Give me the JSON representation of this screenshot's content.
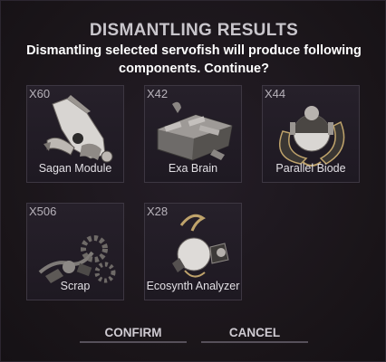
{
  "dialog": {
    "title": "DISMANTLING RESULTS",
    "message": "Dismantling selected servofish will produce following components. Continue?"
  },
  "components": [
    {
      "qty": "X60",
      "name": "Sagan Module",
      "icon": "sagan-module-icon"
    },
    {
      "qty": "X42",
      "name": "Exa Brain",
      "icon": "exa-brain-icon"
    },
    {
      "qty": "X44",
      "name": "Parallel Biode",
      "icon": "parallel-biode-icon"
    },
    {
      "qty": "X506",
      "name": "Scrap",
      "icon": "scrap-icon"
    },
    {
      "qty": "X28",
      "name": "Ecosynth Analyzer",
      "icon": "ecosynth-analyzer-icon"
    }
  ],
  "buttons": {
    "confirm": "CONFIRM",
    "cancel": "CANCEL"
  },
  "colors": {
    "background": "#1c171f",
    "card_border": "#3d3742",
    "title": "#c9c6cc",
    "text": "#ffffff"
  }
}
